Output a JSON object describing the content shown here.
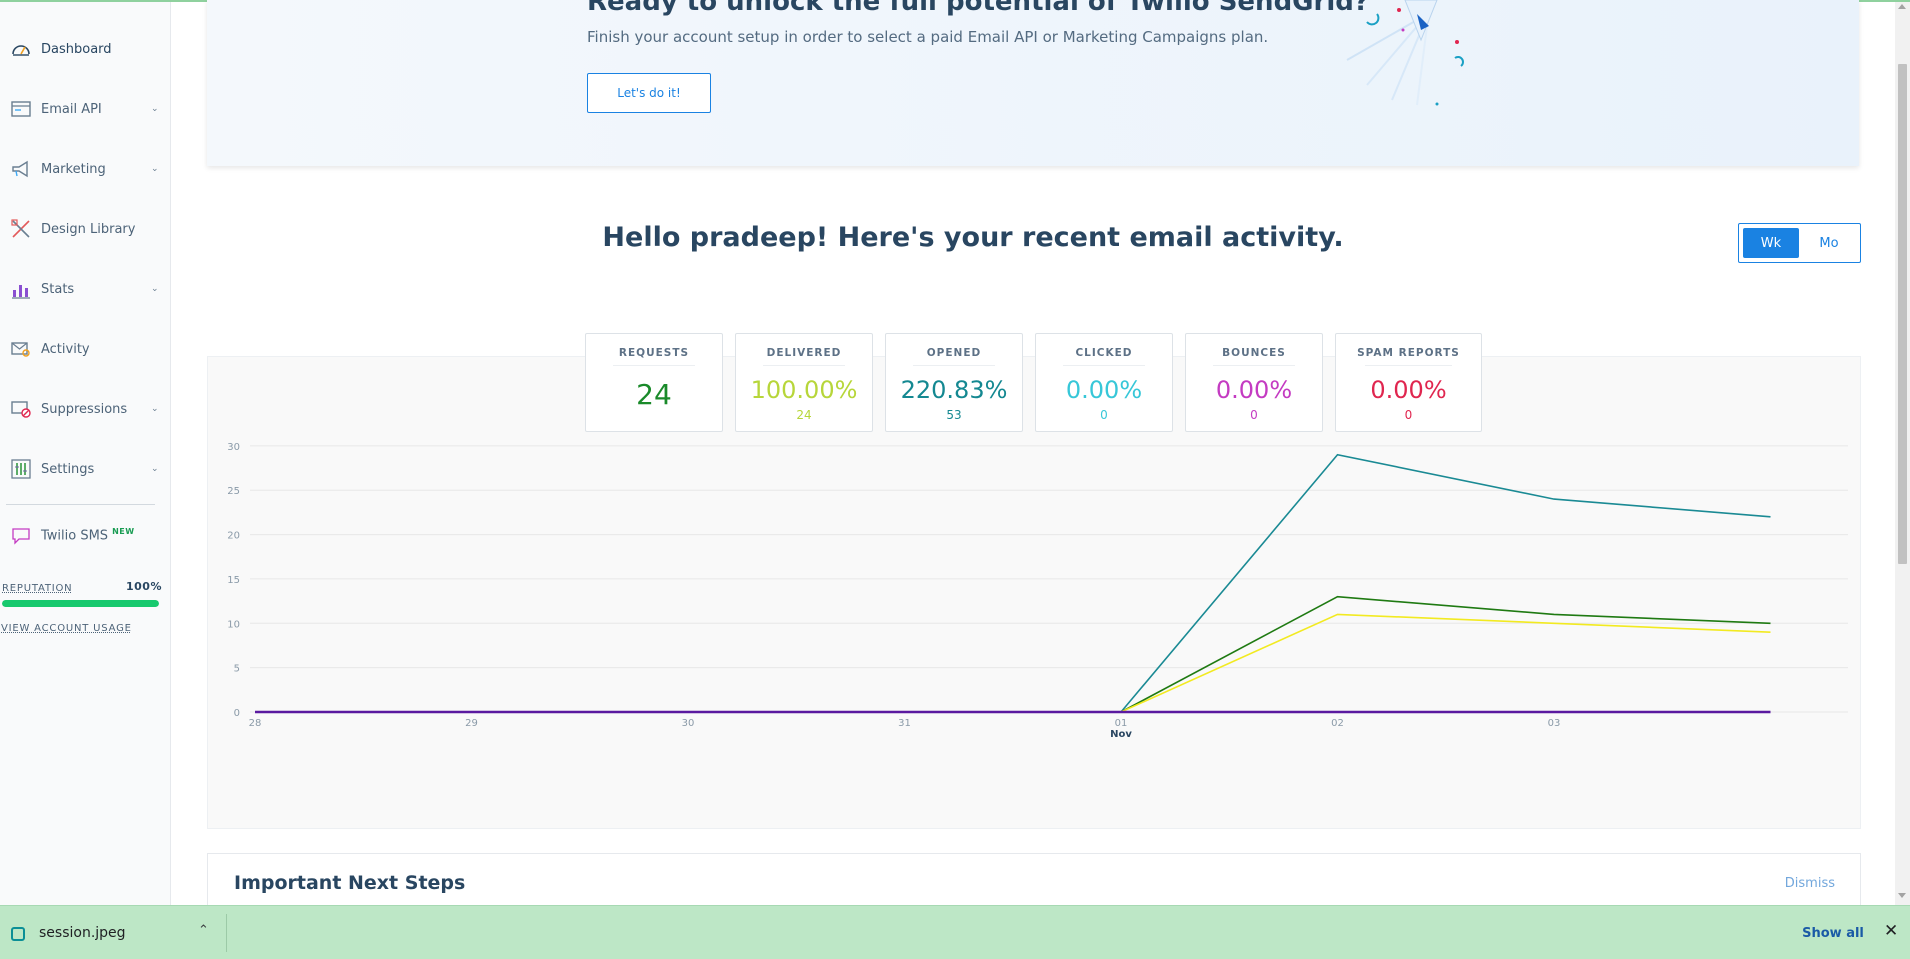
{
  "sidebar": {
    "items": [
      {
        "label": "Dashboard",
        "icon": "dashboard-gauge-icon",
        "has_caret": false
      },
      {
        "label": "Email API",
        "icon": "email-api-icon",
        "has_caret": true
      },
      {
        "label": "Marketing",
        "icon": "megaphone-icon",
        "has_caret": true
      },
      {
        "label": "Design Library",
        "icon": "design-tools-icon",
        "has_caret": false
      },
      {
        "label": "Stats",
        "icon": "bar-stats-icon",
        "has_caret": true
      },
      {
        "label": "Activity",
        "icon": "activity-envelope-icon",
        "has_caret": false
      },
      {
        "label": "Suppressions",
        "icon": "suppression-icon",
        "has_caret": true
      },
      {
        "label": "Settings",
        "icon": "settings-sliders-icon",
        "has_caret": true
      }
    ],
    "sms": {
      "label": "Twilio SMS",
      "badge": "NEW"
    },
    "reputation": {
      "label": "REPUTATION",
      "value": "100%",
      "fraction": 1.0,
      "color": "#18c96e"
    },
    "usage_link": "VIEW ACCOUNT USAGE"
  },
  "banner": {
    "title": "Ready to unlock the full potential of Twilio SendGrid?",
    "subtitle": "Finish your account setup in order to select a paid Email API or Marketing Campaigns plan.",
    "button": "Let's do it!"
  },
  "greeting": "Hello pradeep! Here's your recent email activity.",
  "period_toggle": {
    "week": "Wk",
    "month": "Mo",
    "selected": "Wk"
  },
  "stat_cards": [
    {
      "label": "REQUESTS",
      "value": "24",
      "count": "",
      "color": "#1a8a2a"
    },
    {
      "label": "DELIVERED",
      "value": "100.00%",
      "count": "24",
      "color": "#b7d63a"
    },
    {
      "label": "OPENED",
      "value": "220.83%",
      "count": "53",
      "color": "#148891"
    },
    {
      "label": "CLICKED",
      "value": "0.00%",
      "count": "0",
      "color": "#37c7d8"
    },
    {
      "label": "BOUNCES",
      "value": "0.00%",
      "count": "0",
      "color": "#c43bc2"
    },
    {
      "label": "SPAM REPORTS",
      "value": "0.00%",
      "count": "0",
      "color": "#e0264f"
    }
  ],
  "chart_data": {
    "type": "line",
    "x": [
      "28",
      "29",
      "30",
      "31",
      "01",
      "02",
      "03"
    ],
    "x_month_label": {
      "at": "01",
      "text": "Nov"
    },
    "yticks": [
      0,
      5,
      10,
      15,
      20,
      25,
      30
    ],
    "ylim": [
      0,
      31
    ],
    "grid": true,
    "series": [
      {
        "color": "#1a8a94",
        "values": [
          0,
          0,
          0,
          0,
          0,
          29,
          24,
          22
        ]
      },
      {
        "color": "#1f7a12",
        "values": [
          0,
          0,
          0,
          0,
          0,
          13,
          11,
          10
        ]
      },
      {
        "color": "#f2ea21",
        "values": [
          0,
          0,
          0,
          0,
          0,
          11,
          10,
          9
        ]
      },
      {
        "color": "#5a1aa0",
        "values": [
          0,
          0,
          0,
          0,
          0,
          0,
          0,
          0
        ]
      }
    ]
  },
  "next_steps": {
    "title": "Important Next Steps",
    "dismiss": "Dismiss"
  },
  "download_bar": {
    "file": "session.jpeg",
    "show_all": "Show all"
  }
}
